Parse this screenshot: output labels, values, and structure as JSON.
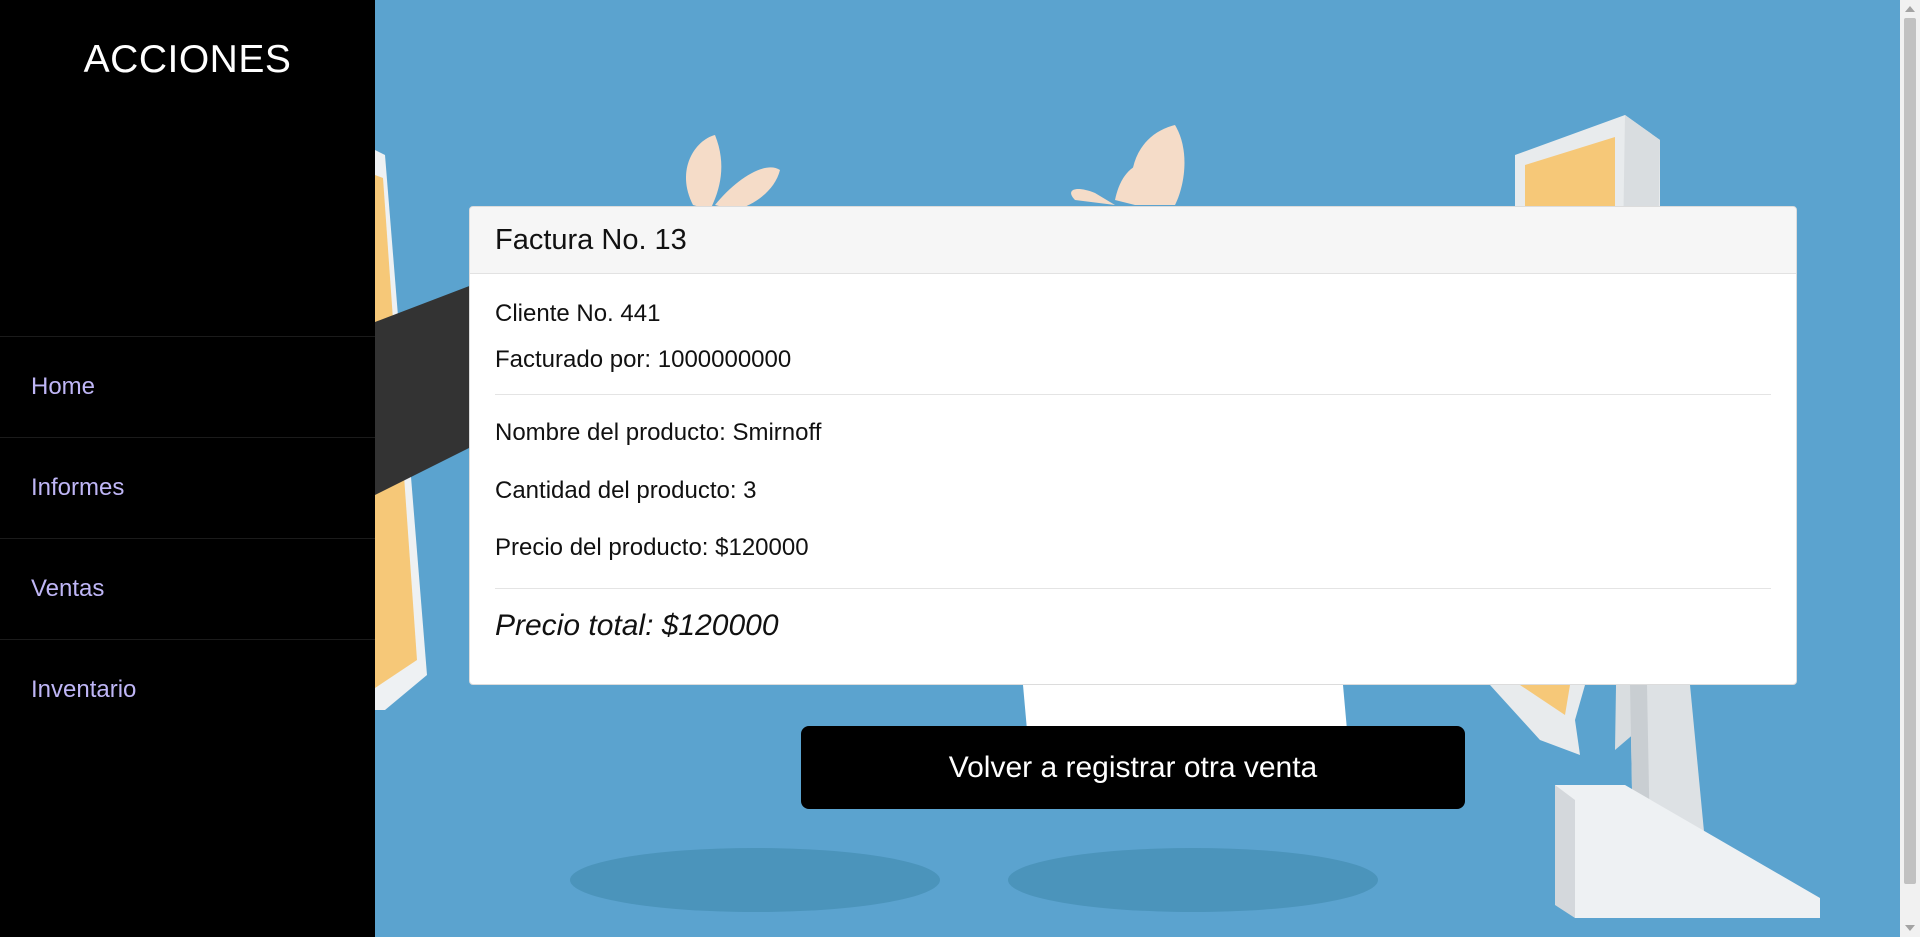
{
  "sidebar": {
    "title": "ACCIONES",
    "items": [
      {
        "label": "Home"
      },
      {
        "label": "Informes"
      },
      {
        "label": "Ventas"
      },
      {
        "label": "Inventario"
      }
    ]
  },
  "invoice": {
    "header": "Factura No. 13",
    "client": "Cliente No. 441",
    "billed_by": "Facturado por: 1000000000",
    "product_name": "Nombre del producto: Smirnoff",
    "product_qty": "Cantidad del producto: 3",
    "product_price": "Precio del producto: $120000",
    "total": "Precio total: $120000"
  },
  "actions": {
    "register_again_label": "Volver a registrar otra venta"
  },
  "colors": {
    "background": "#5ba3cf",
    "sidebar": "#000000",
    "nav_link": "#bfb6f6",
    "button": "#000000"
  }
}
